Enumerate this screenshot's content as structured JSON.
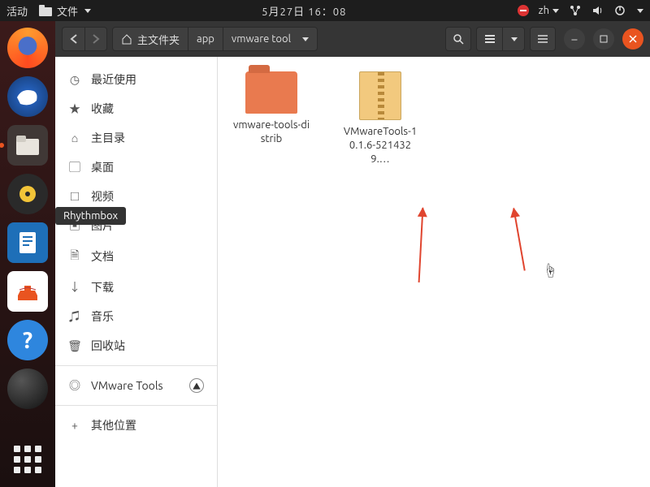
{
  "top_panel": {
    "activities": "活动",
    "app_menu": "文件",
    "clock": "5月27日  16：08",
    "ime": "zh"
  },
  "dock": {
    "tooltip": "Rhythmbox"
  },
  "window": {
    "path": {
      "home": "主文件夹",
      "seg1": "app",
      "seg2": "vmware tool"
    }
  },
  "sidebar": {
    "recent": "最近使用",
    "starred": "收藏",
    "home": "主目录",
    "desktop": "桌面",
    "videos": "视频",
    "pictures": "图片",
    "documents": "文档",
    "downloads": "下载",
    "music": "音乐",
    "trash": "回收站",
    "vmware": "VMware Tools",
    "other": "其他位置"
  },
  "files": {
    "folder": "vmware-tools-distrib",
    "archive": "VMwareTools-10.1.6-5214329.…"
  }
}
